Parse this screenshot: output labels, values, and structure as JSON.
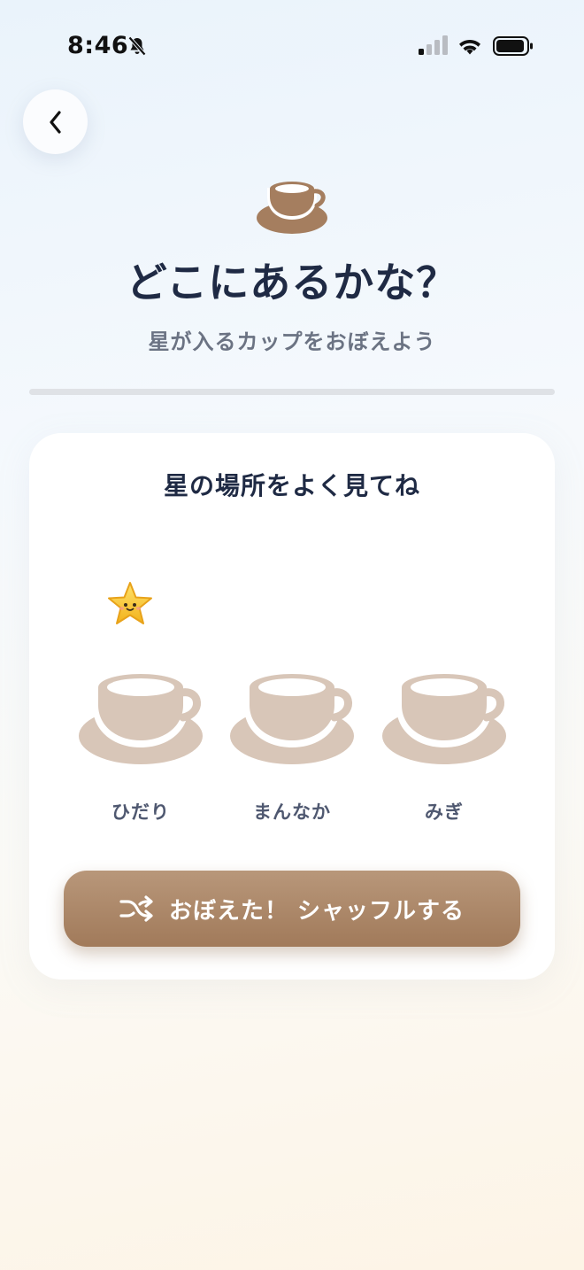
{
  "status_bar": {
    "time": "8:46",
    "icons": [
      "bell-slash-icon",
      "cellular-signal-icon",
      "wifi-icon",
      "battery-icon"
    ]
  },
  "header": {
    "back_icon": "chevron-left-icon",
    "cup_icon": "coffee-cup-icon",
    "title": "どこにあるかな？",
    "subtitle": "星が入るカップをおぼえよう"
  },
  "progress": {
    "fraction": 0
  },
  "card": {
    "heading": "星の場所をよく見てね",
    "star_icon": "smiling-star-icon",
    "star_position": "left",
    "cups": [
      {
        "id": "left",
        "label": "ひだり"
      },
      {
        "id": "middle",
        "label": "まんなか"
      },
      {
        "id": "right",
        "label": "みぎ"
      }
    ],
    "shuffle_button": {
      "icon": "shuffle-icon",
      "label": "おぼえた！ シャッフルする"
    }
  },
  "colors": {
    "accent_brown": "#a57e5f",
    "cup_fill": "#d8c6b8",
    "title_navy": "#1f2a44",
    "subtitle_gray": "#6b7383"
  }
}
